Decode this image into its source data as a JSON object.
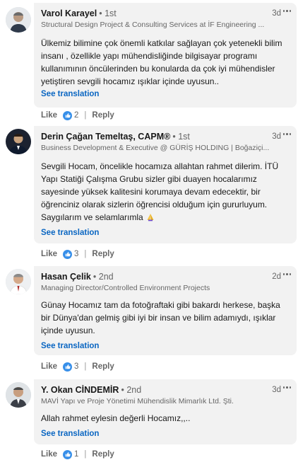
{
  "ui": {
    "see_translation": "See translation",
    "like": "Like",
    "reply": "Reply",
    "separator": "|",
    "dot": "•"
  },
  "comments": [
    {
      "name": "Varol Karayel",
      "degree": "1st",
      "headline": "Structural Design Project & Consulting Services at İF Engineering ...",
      "time": "3d",
      "lines": [
        "Ülkemiz bilimine çok önemli katkılar sağlayan çok yetenekli bilim",
        "insanı , özellikle yapı mühendisliğinde bilgisayar programı",
        "kullanımının öncülerinden bu konularda da çok iyi mühendisler",
        "yetiştiren sevgili hocamız ışıklar içinde uyusun.."
      ],
      "reactions": "2"
    },
    {
      "name": "Derin Çağan Temeltaş, CAPM®",
      "degree": "1st",
      "headline": "Business Development & Executive @ GÜRİŞ HOLDING | Boğaziçi...",
      "time": "3d",
      "lines": [
        "Sevgili Hocam, öncelikle hocamıza allahtan rahmet dilerim. İTÜ",
        "Yapı Statiği Çalışma Grubu sizler gibi duayen hocalarımız",
        "sayesinde yüksek kalitesini korumaya devam edecektir, bir",
        "öğrenciniz olarak sizlerin öğrencisi olduğum için gururluyum.",
        "Saygılarım ve selamlarımla"
      ],
      "reactions": "3"
    },
    {
      "name": "Hasan Çelik",
      "degree": "2nd",
      "headline": "Managing Director/Controlled Environment Projects",
      "time": "2d",
      "lines": [
        "Günay Hocamız tam da fotoğraftaki gibi bakardı herkese, başka",
        "bir Dünya'dan gelmiş gibi iyi bir insan ve bilim adamıydı, ışıklar",
        "içinde uyusun."
      ],
      "reactions": "3"
    },
    {
      "name": "Y. Okan CİNDEMİR",
      "degree": "2nd",
      "headline": "MAVİ Yapı ve Proje Yönetimi Mühendislik Mimarlık Ltd. Şti.",
      "time": "3d",
      "lines": [
        "Allah rahmet eylesin değerli Hocamız,,.."
      ],
      "reactions": "1"
    }
  ]
}
